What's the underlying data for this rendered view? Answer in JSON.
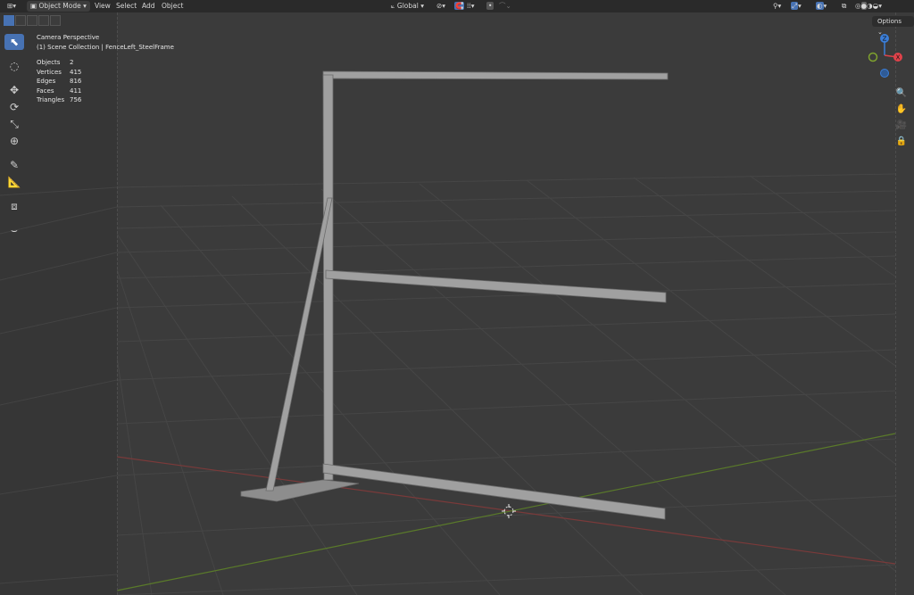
{
  "header": {
    "editor_icon": "3d-viewport-icon",
    "mode_label": "Object Mode",
    "menus": [
      "View",
      "Select",
      "Add",
      "Object"
    ],
    "transform_orientation": "Global"
  },
  "options_label": "Options",
  "overlay": {
    "view_name": "Camera Perspective",
    "collection_path": "(1) Scene Collection | FenceLeft_SteelFrame"
  },
  "stats": [
    {
      "label": "Objects",
      "value": "2"
    },
    {
      "label": "Vertices",
      "value": "415"
    },
    {
      "label": "Edges",
      "value": "816"
    },
    {
      "label": "Faces",
      "value": "411"
    },
    {
      "label": "Triangles",
      "value": "756"
    }
  ],
  "gizmo": {
    "z_label": "Z",
    "x_label": "X",
    "x_color": "#e0424a",
    "y_color": "#7fa22e",
    "z_color": "#3b7ed8"
  },
  "tools": [
    "select-box-icon",
    "cursor-icon",
    "move-icon",
    "rotate-icon",
    "scale-icon",
    "transform-icon",
    "annotate-icon",
    "measure-icon",
    "add-cube-icon",
    "curve-icon"
  ],
  "nav_icons": [
    "zoom-icon",
    "hand-pan-icon",
    "camera-icon",
    "lock-icon"
  ],
  "colors": {
    "background": "#3b3b3b",
    "grid": "#474747",
    "x_axis": "#8c3a3a",
    "y_axis": "#5b7a2a",
    "active_tool": "#4772b3",
    "steel": "#9e9e9e"
  }
}
